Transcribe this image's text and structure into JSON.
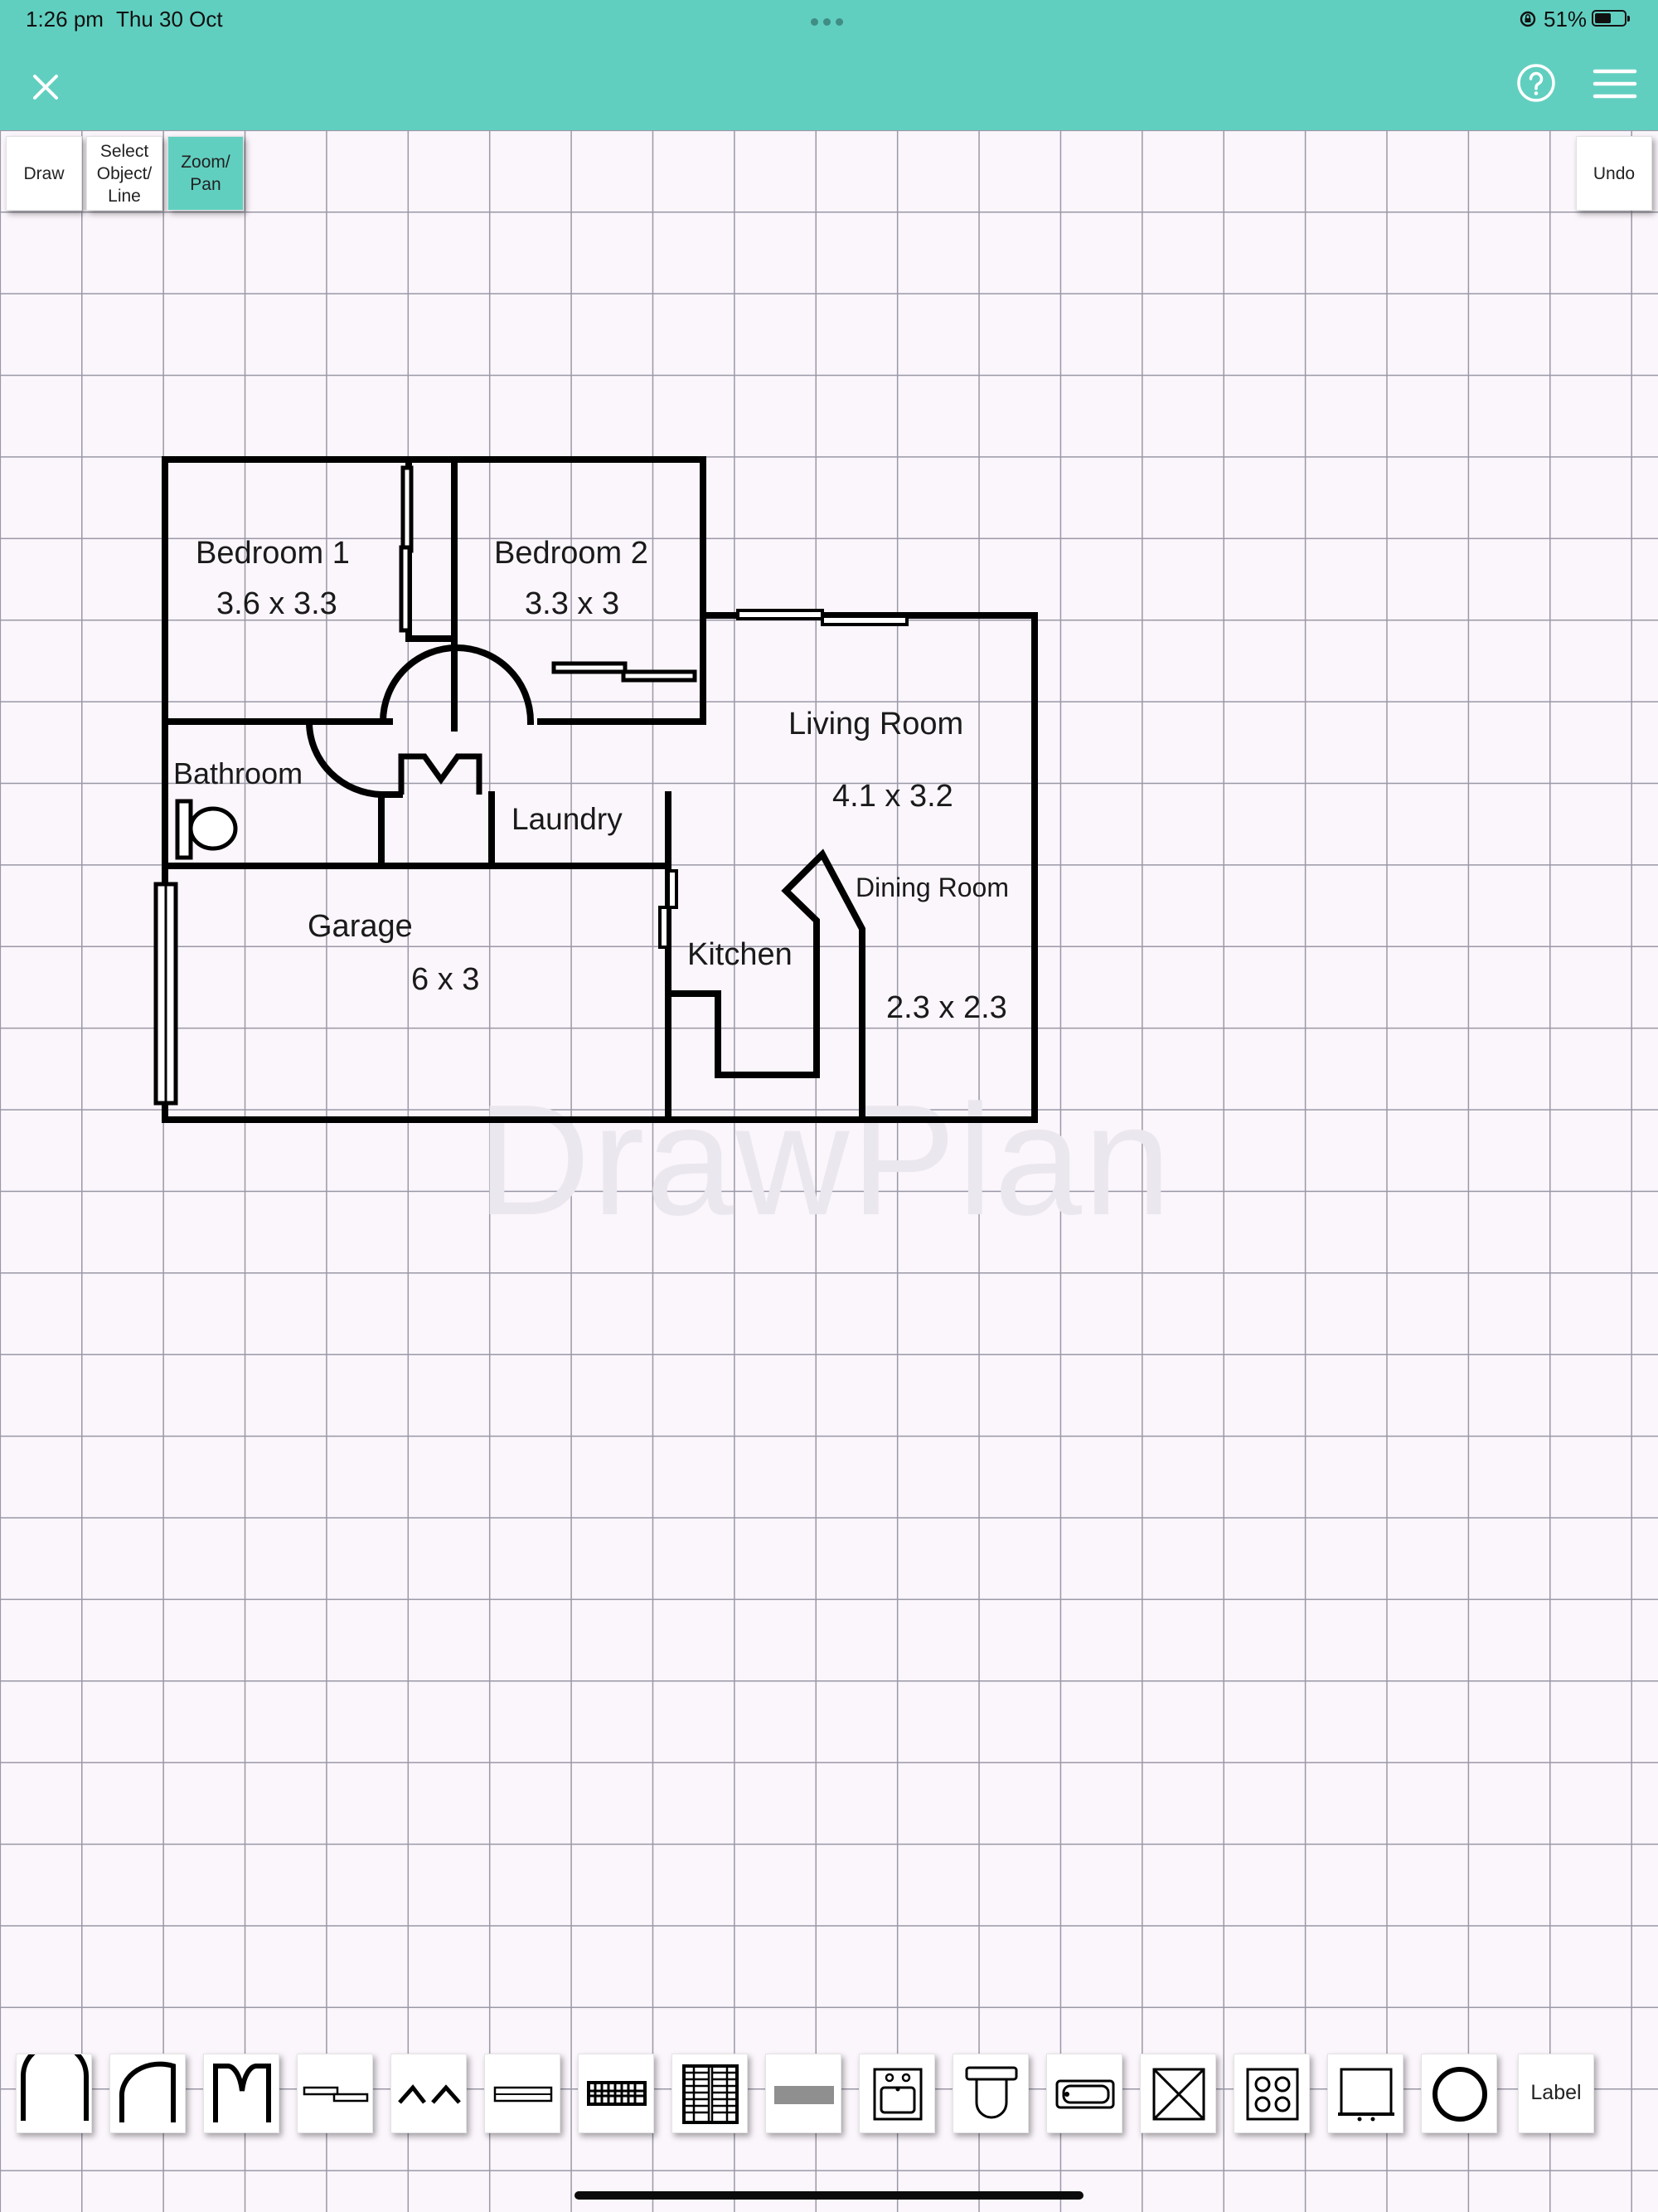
{
  "status_bar": {
    "time": "1:26 pm",
    "date": "Thu 30 Oct",
    "battery": "51%"
  },
  "toolbar": {
    "modes": [
      {
        "label": "Draw"
      },
      {
        "label": "Select\nObject/\nLine"
      },
      {
        "label": "Zoom/\nPan",
        "active": true
      }
    ],
    "undo_label": "Undo"
  },
  "plan": {
    "rooms": [
      {
        "name": "Bedroom 1",
        "size": "3.6 x 3.3"
      },
      {
        "name": "Bedroom 2",
        "size": "3.3 x 3"
      },
      {
        "name": "Living Room",
        "size": "4.1 x 3.2"
      },
      {
        "name": "Bathroom"
      },
      {
        "name": "Laundry"
      },
      {
        "name": "Dining Room",
        "size": "2.3 x 2.3"
      },
      {
        "name": "Garage",
        "size": "6 x 3"
      },
      {
        "name": "Kitchen"
      }
    ],
    "watermark": "DrawPlan"
  },
  "palette": {
    "items": [
      "door-icon",
      "arched-door-icon",
      "double-door-icon",
      "sliding-door-icon",
      "bifold-door-icon",
      "window-icon",
      "stairs-icon",
      "staircase-icon",
      "bench-icon",
      "sink-icon",
      "toilet-icon",
      "bathtub-icon",
      "box-icon",
      "cooktop-icon",
      "cabinet-icon",
      "circle-icon"
    ],
    "label_button": "Label"
  },
  "colors": {
    "accent": "#61cfc0",
    "canvas": "#fbf6fc",
    "grid": "#9a98a6",
    "wall": "#000000"
  }
}
